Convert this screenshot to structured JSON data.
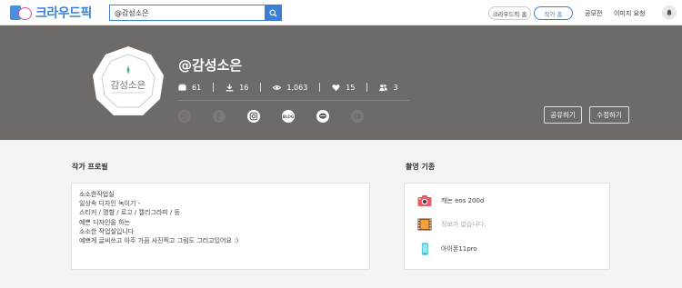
{
  "header": {
    "logo_text": "크라우드픽",
    "search": {
      "value": "@감성소은"
    },
    "crowdpic_home_label": "크라우드픽 홈",
    "artist_home_label": "작가 홈",
    "contest_label": "공모전",
    "image_request_label": "이미지 요청"
  },
  "profile": {
    "avatar_text": "감성소은",
    "username": "@감성소은",
    "stats": {
      "images": "61",
      "downloads": "16",
      "views": "1,063",
      "likes": "15",
      "followers": "3"
    },
    "social": {
      "blog_label": "BLOG"
    },
    "share_label": "공유하기",
    "edit_label": "수정하기"
  },
  "artist_profile": {
    "title": "작가 프로필",
    "bio_lines": [
      "소소한작업실",
      "일상속 디자인 녹이기 -",
      "스티커 / 명함 / 로고 / 캘리그라피 / 등",
      "예쁜 디자인을 하는",
      "소소한 작업실입니다",
      "예쁘게 글씨쓰고 아주 가끔 사진찍고 그림도 그리고있어요 :)"
    ]
  },
  "shooting_gear": {
    "title": "촬영 기종",
    "items": [
      {
        "icon": "camera-icon",
        "label": "캐논 eos 200d"
      },
      {
        "icon": "film-icon",
        "label": "정보가 없습니다."
      },
      {
        "icon": "phone-icon",
        "label": "아이폰11pro"
      }
    ]
  },
  "colors": {
    "brand_blue": "#3b7fd4",
    "banner": "#6e6a67",
    "camera_red": "#e85a6a",
    "phone_teal": "#4cc6d6"
  }
}
